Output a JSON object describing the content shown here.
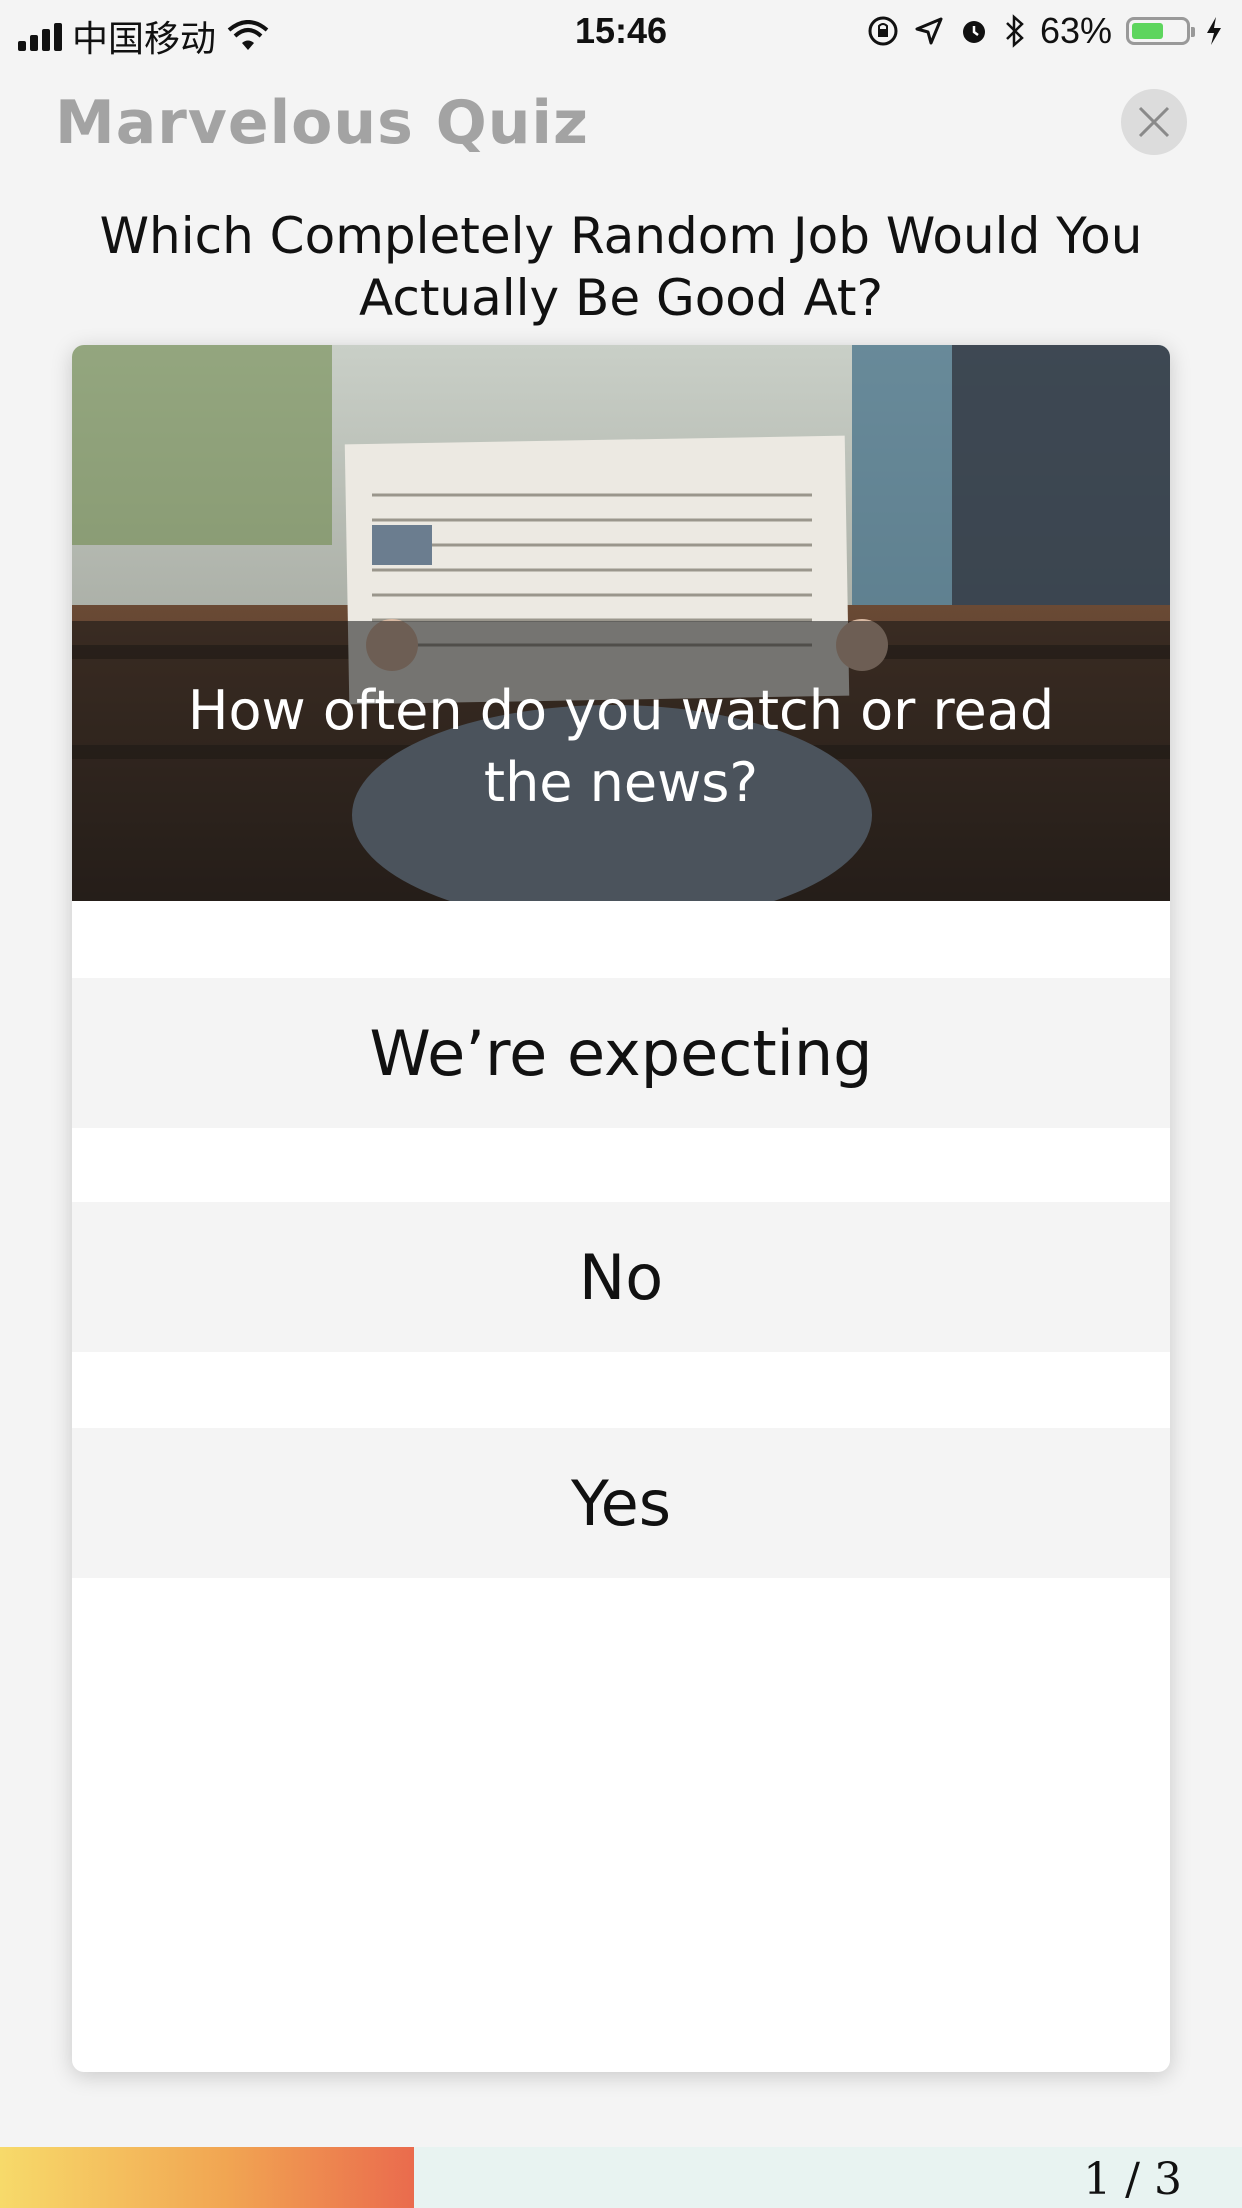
{
  "status_bar": {
    "carrier": "中国移动",
    "time": "15:46",
    "battery_percent": "63%",
    "battery_level": 0.63
  },
  "header": {
    "app_title": "Marvelous Quiz",
    "close_icon": "close-icon"
  },
  "quiz": {
    "title": "Which Completely Random Job Would You Actually Be Good At?",
    "question": "How often do you watch or read the news?",
    "answers": [
      "We’re expecting",
      "No",
      "Yes"
    ]
  },
  "progress": {
    "label": "1 / 3",
    "fraction": 0.333
  },
  "colors": {
    "title_gray": "#a3a3a3",
    "answer_bg": "#f4f4f4",
    "progress_start": "#f7da6a",
    "progress_end": "#ea6b4d",
    "progress_track": "#e8f3f1"
  }
}
